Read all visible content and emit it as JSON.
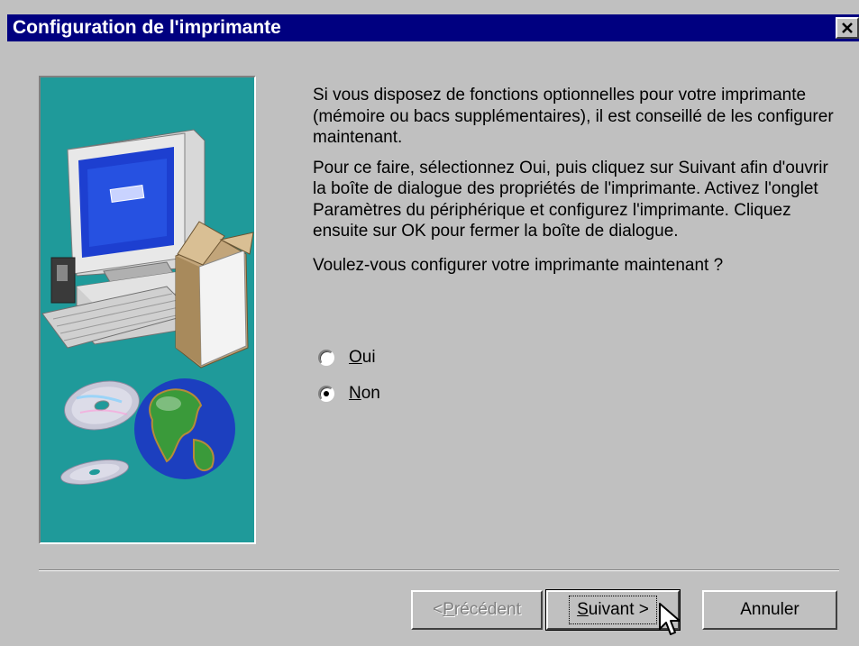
{
  "window": {
    "title": "Configuration de l'imprimante",
    "close_icon": "close-icon"
  },
  "illustration": {
    "background": "#1f9a9a",
    "content": [
      "computer-monitor",
      "desktop-tower",
      "keyboard",
      "box",
      "cd-discs",
      "globe"
    ]
  },
  "body": {
    "paragraph1": "Si vous disposez de fonctions optionnelles pour votre imprimante (mémoire ou bacs supplémentaires), il est conseillé de les configurer maintenant.",
    "paragraph2": "Pour ce faire, sélectionnez Oui, puis cliquez sur Suivant afin d'ouvrir la boîte de dialogue des propriétés de l'imprimante. Activez l'onglet Paramètres du périphérique et configurez l'imprimante. Cliquez ensuite sur OK pour fermer la boîte de dialogue.",
    "question": "Voulez-vous configurer votre imprimante maintenant ?"
  },
  "options": [
    {
      "accel": "O",
      "rest": "ui",
      "selected": false
    },
    {
      "accel": "N",
      "rest": "on",
      "selected": true
    }
  ],
  "buttons": {
    "back": {
      "prefix": "< ",
      "accel": "P",
      "rest": "récédent",
      "enabled": false
    },
    "next": {
      "accel": "S",
      "rest": "uivant >",
      "enabled": true
    },
    "cancel": {
      "label": "Annuler",
      "enabled": true
    }
  },
  "colors": {
    "titlebar": "#000080",
    "face": "#c0c0c0"
  }
}
